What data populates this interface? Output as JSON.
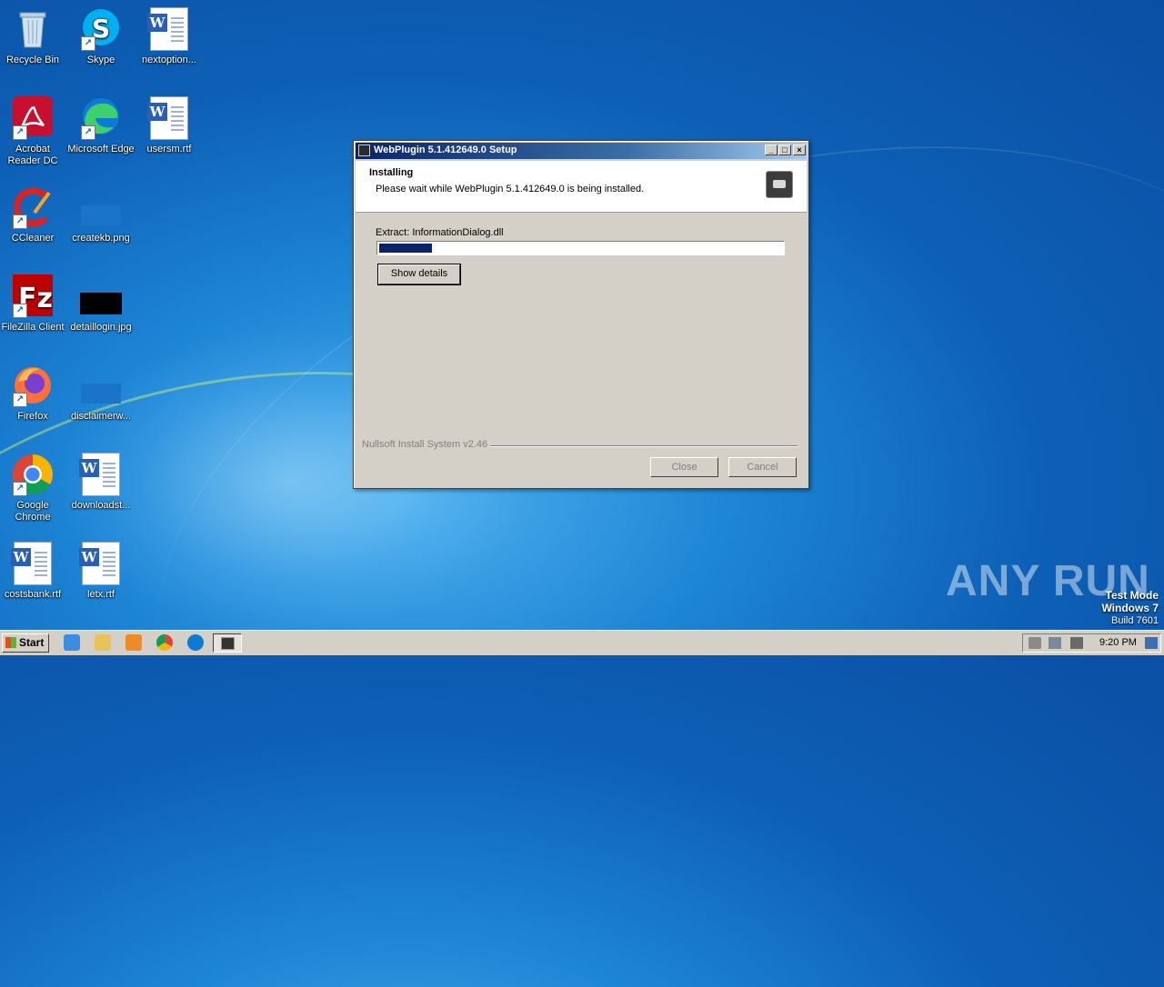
{
  "desktop": {
    "icons": [
      {
        "label": "Recycle Bin"
      },
      {
        "label": "Skype"
      },
      {
        "label": "nextoption..."
      },
      {
        "label": "Acrobat Reader DC"
      },
      {
        "label": "Microsoft Edge"
      },
      {
        "label": "usersm.rtf"
      },
      {
        "label": "CCleaner"
      },
      {
        "label": "createkb.png"
      },
      {
        "label": "FileZilla Client"
      },
      {
        "label": "detaillogin.jpg"
      },
      {
        "label": "Firefox"
      },
      {
        "label": "disclaimerw..."
      },
      {
        "label": "Google Chrome"
      },
      {
        "label": "downloadst..."
      },
      {
        "label": "costsbank.rtf"
      },
      {
        "label": "letx.rtf"
      }
    ]
  },
  "dialog": {
    "title": "WebPlugin 5.1.412649.0 Setup",
    "header_title": "Installing",
    "header_subtitle": "Please wait while WebPlugin 5.1.412649.0 is being installed.",
    "status": "Extract: InformationDialog.dll",
    "progress": 0.13,
    "show_details_label": "Show details",
    "branding": "Nullsoft Install System v2.46",
    "close_label": "Close",
    "cancel_label": "Cancel",
    "minimize_glyph": "_",
    "maximize_glyph": "□",
    "close_glyph": "×"
  },
  "watermark": {
    "brand": "ANY RUN",
    "line1": "Test Mode",
    "line2": "Windows 7",
    "line3": "Build 7601"
  },
  "taskbar": {
    "start_label": "Start",
    "clock": "9:20 PM",
    "pinned": [
      "internet-explorer-icon",
      "file-explorer-icon",
      "media-player-icon",
      "chrome-icon",
      "edge-icon"
    ]
  },
  "colors": {
    "title_gradient_start": "#0a246a",
    "progress_fill": "#0a246a",
    "desktop_blue": "#0d5fb6"
  }
}
